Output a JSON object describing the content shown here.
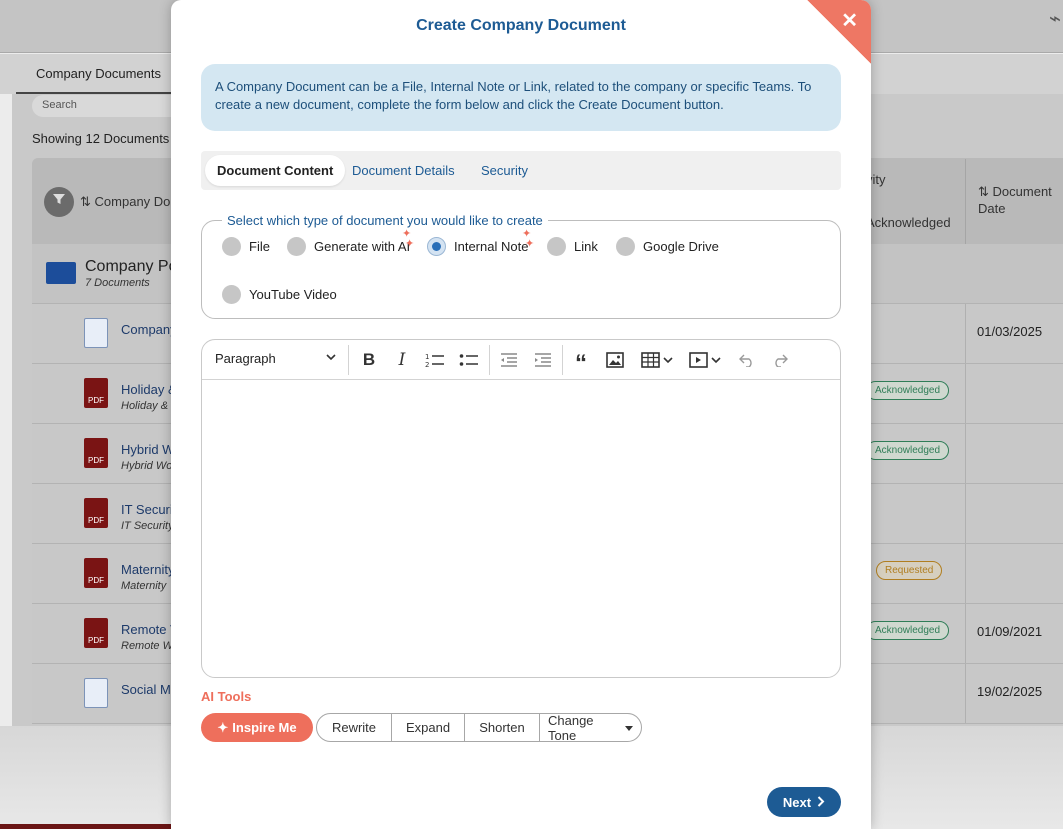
{
  "background": {
    "tab_label": "Company Documents",
    "search_placeholder": "Search",
    "showing_text": "Showing 12 Documents",
    "col_company_doc": "Company Do",
    "col_activity": "vity",
    "col_acknowledged": "Acknowledged",
    "col_document_date": "Document Date",
    "folder": {
      "title": "Company Po",
      "subtitle": "7 Documents"
    },
    "rows": [
      {
        "title": "Company",
        "subtitle": "",
        "icon": "doc-icon",
        "badge": "",
        "date": "01/03/2025"
      },
      {
        "title": "Holiday &",
        "subtitle": "Holiday &",
        "icon": "pdf-icon",
        "badge": "Acknowledged",
        "date": ""
      },
      {
        "title": "Hybrid W",
        "subtitle": "Hybrid Wo",
        "icon": "pdf-icon",
        "badge": "Acknowledged",
        "date": ""
      },
      {
        "title": "IT Securi",
        "subtitle": "IT Security",
        "icon": "pdf-icon",
        "badge": "",
        "date": ""
      },
      {
        "title": "Maternity",
        "subtitle": "Maternity",
        "icon": "pdf-icon",
        "badge": "Requested",
        "date": ""
      },
      {
        "title": "Remote V",
        "subtitle": "Remote W",
        "icon": "pdf-icon",
        "badge": "Acknowledged",
        "date": "01/09/2021"
      },
      {
        "title": "Social M",
        "subtitle": "",
        "icon": "doc-icon",
        "badge": "",
        "date": "19/02/2025"
      }
    ],
    "pdf_label": "PDF"
  },
  "modal": {
    "title": "Create Company Document",
    "close_glyph": "✕",
    "info": "A Company Document can be a File, Internal Note or Link, related to the company or specific Teams. To create a new document, complete the form below and click the Create Document button.",
    "tabs": [
      {
        "label": "Document Content",
        "active": true
      },
      {
        "label": "Document Details",
        "active": false
      },
      {
        "label": "Security",
        "active": false
      }
    ],
    "type_legend": "Select which type of document you would like to create",
    "types": [
      {
        "label": "File",
        "checked": false
      },
      {
        "label": "Generate with AI",
        "checked": false
      },
      {
        "label": "Internal Note",
        "checked": true
      },
      {
        "label": "Link",
        "checked": false
      },
      {
        "label": "Google Drive",
        "checked": false
      },
      {
        "label": "YouTube Video",
        "checked": false
      }
    ],
    "editor": {
      "paragraph_label": "Paragraph",
      "body_text": ""
    },
    "ai_tools_label": "AI Tools",
    "ai_buttons": {
      "inspire": "Inspire Me",
      "rewrite": "Rewrite",
      "expand": "Expand",
      "shorten": "Shorten",
      "change_tone": "Change Tone"
    },
    "next_label": "Next"
  },
  "colors": {
    "accent_blue": "#1d5b94",
    "ai_coral": "#ee6f5c",
    "info_bg": "#d4e7f2"
  }
}
